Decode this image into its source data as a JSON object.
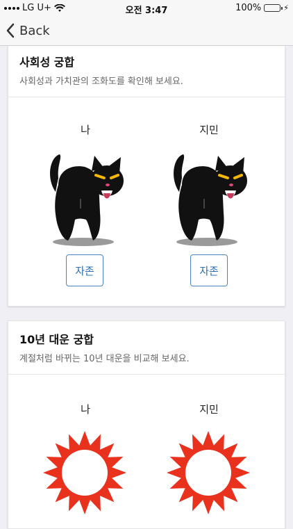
{
  "status": {
    "carrier": "LG U+",
    "time": "오전 3:47",
    "battery": "100%",
    "battery_level": 1.0
  },
  "nav": {
    "back_label": "Back"
  },
  "social_card": {
    "title": "사회성 궁합",
    "subtitle": "사회성과 가치관의 조화도를 확인해 보세요.",
    "left": {
      "name": "나",
      "icon": "black-cat-icon",
      "button": "자존"
    },
    "right": {
      "name": "지민",
      "icon": "black-cat-icon",
      "button": "자존"
    }
  },
  "decade_card": {
    "title": "10년 대운 궁합",
    "subtitle": "계절처럼 바뀌는 10년 대운을 비교해 보세요.",
    "left": {
      "name": "나",
      "icon": "red-sun-icon"
    },
    "right": {
      "name": "지민",
      "icon": "red-sun-icon"
    }
  },
  "colors": {
    "accent": "#2a6fb8",
    "sun": "#e8321e",
    "battery": "#4cd964"
  }
}
